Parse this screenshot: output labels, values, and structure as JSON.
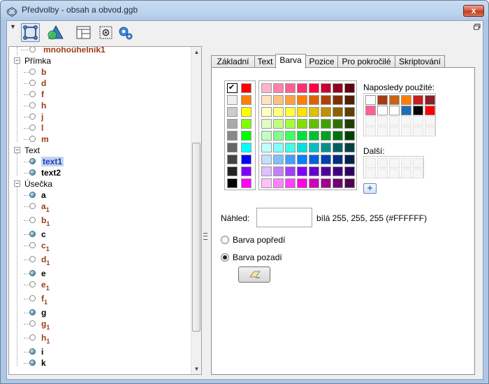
{
  "window": {
    "title": "Předvolby - obsah a obvod.ggb",
    "close_label": "x"
  },
  "toolbar": {
    "buttons": [
      {
        "icon": "selection-icon",
        "selected": true
      },
      {
        "icon": "geometry-icon"
      },
      {
        "icon": "layout-icon"
      },
      {
        "icon": "defaults-icon"
      },
      {
        "icon": "settings-gear-icon"
      }
    ]
  },
  "tree": {
    "partial_top": "mnohoúhelník1",
    "groups": [
      {
        "label": "Přímka",
        "items": [
          {
            "name": "b"
          },
          {
            "name": "d"
          },
          {
            "name": "f"
          },
          {
            "name": "h"
          },
          {
            "name": "j"
          },
          {
            "name": "l"
          },
          {
            "name": "m"
          }
        ]
      },
      {
        "label": "Text",
        "items": [
          {
            "name": "text1",
            "selected": true
          },
          {
            "name": "text2"
          }
        ]
      },
      {
        "label": "Úsečka",
        "items": [
          {
            "name": "a",
            "sub": "",
            "filled": true
          },
          {
            "name": "a",
            "sub": "1",
            "filled": false
          },
          {
            "name": "b",
            "sub": "1",
            "filled": false
          },
          {
            "name": "c",
            "sub": "",
            "filled": true
          },
          {
            "name": "c",
            "sub": "1",
            "filled": false
          },
          {
            "name": "d",
            "sub": "1",
            "filled": false
          },
          {
            "name": "e",
            "sub": "",
            "filled": true
          },
          {
            "name": "e",
            "sub": "1",
            "filled": false
          },
          {
            "name": "f",
            "sub": "1",
            "filled": false
          },
          {
            "name": "g",
            "sub": "",
            "filled": true
          },
          {
            "name": "g",
            "sub": "1",
            "filled": false
          },
          {
            "name": "h",
            "sub": "1",
            "filled": false
          },
          {
            "name": "i",
            "sub": "",
            "filled": true
          },
          {
            "name": "k",
            "sub": "",
            "filled": true
          }
        ]
      }
    ]
  },
  "tabs": [
    {
      "label": "Základní"
    },
    {
      "label": "Text"
    },
    {
      "label": "Barva",
      "active": true
    },
    {
      "label": "Pozice"
    },
    {
      "label": "Pro pokročilé"
    },
    {
      "label": "Skriptování"
    }
  ],
  "color": {
    "recent_label": "Naposledy použité:",
    "more_label": "Další:",
    "preview_label": "Náhled:",
    "preview_value": "bílá 255, 255, 255 (#FFFFFF)",
    "foreground_label": "Barva popředí",
    "background_label": "Barva pozadí",
    "add_label": "+",
    "selected_radio": "background",
    "left_palette": [
      [
        "#ffffff",
        "#ff0000"
      ],
      [
        "#eeeeee",
        "#ff8000"
      ],
      [
        "#cccccc",
        "#ffff00"
      ],
      [
        "#aaaaaa",
        "#80ff00"
      ],
      [
        "#888888",
        "#00ff00"
      ],
      [
        "#666666",
        "#00ffff"
      ],
      [
        "#444444",
        "#0000ff"
      ],
      [
        "#222222",
        "#8000ff"
      ],
      [
        "#000000",
        "#ff00ff"
      ]
    ],
    "main_palette": [
      [
        "#ffb3c9",
        "#ff80b0",
        "#ff6090",
        "#ff3070",
        "#ff0040",
        "#c80030",
        "#900020",
        "#600010"
      ],
      [
        "#ffe0c0",
        "#ffc080",
        "#ffa040",
        "#ff8000",
        "#e06000",
        "#b04000",
        "#803000",
        "#502000"
      ],
      [
        "#ffffc0",
        "#ffff80",
        "#ffff40",
        "#ffe000",
        "#e0c000",
        "#c09000",
        "#906000",
        "#604000"
      ],
      [
        "#e0ffc0",
        "#c0ff80",
        "#a0ff40",
        "#80e000",
        "#60c000",
        "#40a000",
        "#307000",
        "#204000"
      ],
      [
        "#c0ffc0",
        "#80ff90",
        "#40ff60",
        "#00e040",
        "#00c030",
        "#00a020",
        "#007010",
        "#004000"
      ],
      [
        "#c0ffff",
        "#80ffff",
        "#40ffe0",
        "#00e0e0",
        "#00c0c0",
        "#009090",
        "#006060",
        "#004040"
      ],
      [
        "#c0e0ff",
        "#80c0ff",
        "#40a0ff",
        "#0080ff",
        "#0060e0",
        "#0040b0",
        "#003080",
        "#002050"
      ],
      [
        "#e0c0ff",
        "#c080ff",
        "#a040ff",
        "#8000ff",
        "#6000d0",
        "#5000a0",
        "#400080",
        "#300060"
      ],
      [
        "#ffc0ff",
        "#ff80ff",
        "#ff40ff",
        "#ff00e0",
        "#d000c0",
        "#a00090",
        "#700070",
        "#500050"
      ]
    ],
    "recent_swatches": [
      "#ffffff",
      "#a63c14",
      "#c86414",
      "#ff8000",
      "#c81e1e",
      "#8c1e28",
      "#ff6090",
      "#ffffff",
      "#ffffff",
      "#1e6eb4",
      "#000000",
      "#ff0000"
    ]
  }
}
